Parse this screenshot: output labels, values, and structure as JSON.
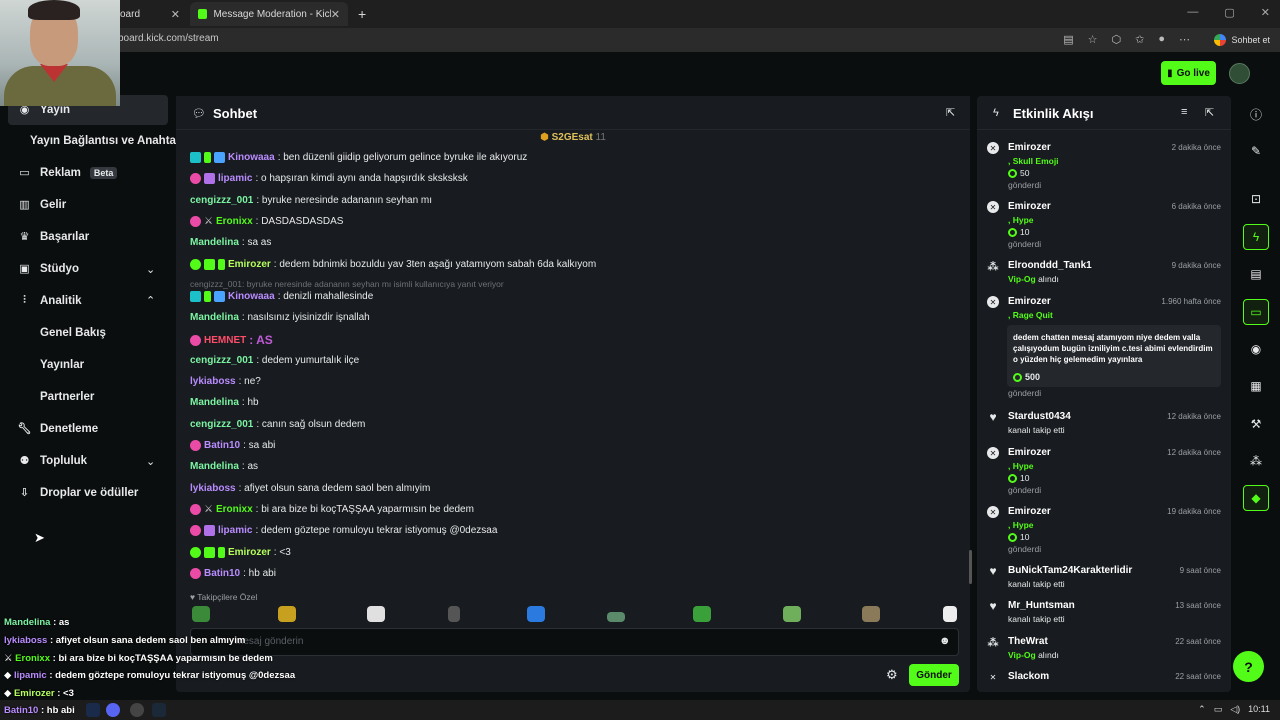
{
  "browser": {
    "tabs": [
      {
        "label": "oard",
        "active": false
      },
      {
        "label": "Message Moderation - Kick Dashb",
        "active": true
      }
    ],
    "new_tab": "+",
    "url": "board.kick.com/stream",
    "sohbet_et": "Sohbet et"
  },
  "appbar": {
    "go_live": "Go live"
  },
  "sidebar": {
    "items": [
      {
        "label": "Yayın"
      },
      {
        "label": "Yayın Bağlantısı ve Anahtarı"
      },
      {
        "label": "Reklam",
        "badge": "Beta"
      },
      {
        "label": "Gelir"
      },
      {
        "label": "Başarılar"
      },
      {
        "label": "Stüdyo"
      },
      {
        "label": "Analitik"
      },
      {
        "label": "Genel Bakış"
      },
      {
        "label": "Yayınlar"
      },
      {
        "label": "Partnerler"
      },
      {
        "label": "Denetleme"
      },
      {
        "label": "Topluluk"
      },
      {
        "label": "Droplar ve ödüller"
      }
    ]
  },
  "chat": {
    "title": "Sohbet",
    "pinned": {
      "user": "S2GEsat",
      "count": "11"
    },
    "messages": [
      {
        "user": "Kinowaaa",
        "text": ": ben düzenli giidip geliyorum gelince byruke ile akıyoruz"
      },
      {
        "user": "lipamic",
        "text": ": o hapşıran kimdi aynı anda hapşırdık sksksksk"
      },
      {
        "user": "cengizzz_001",
        "text": ": byruke neresinde adananın seyhan mı"
      },
      {
        "user": "Eronixx",
        "text": ": DASDASDASDAS"
      },
      {
        "user": "Mandelina",
        "text": ": sa as"
      },
      {
        "user": "Emirozer",
        "text": ": dedem bdnimki bozuldu yav 3ten aşağı yatamıyom sabah 6da kalkıyom"
      },
      {
        "user": "Kinowaaa",
        "text": ": denizli mahallesinde"
      },
      {
        "user": "Mandelina",
        "text": ": nasılsınız iyisinizdir işnallah"
      },
      {
        "user": "HEMNET",
        "text": ": AS"
      },
      {
        "user": "cengizzz_001",
        "text": ": dedem yumurtalık ilçe"
      },
      {
        "user": "lykiaboss",
        "text": ": ne?"
      },
      {
        "user": "Mandelina",
        "text": ": hb"
      },
      {
        "user": "cengizzz_001",
        "text": ": canın sağ olsun dedem"
      },
      {
        "user": "Batin10",
        "text": ": sa abi"
      },
      {
        "user": "Mandelina",
        "text": ": as"
      },
      {
        "user": "lykiaboss",
        "text": ": afiyet olsun sana dedem saol ben almıyim"
      },
      {
        "user": "Eronixx",
        "text": ": bi ara bize bi koçTAŞŞAA yaparmısın be dedem"
      },
      {
        "user": "lipamic",
        "text": ": dedem göztepe romuloyu tekrar istiyomuş @0dezsaa"
      },
      {
        "user": "Emirozer",
        "text": ": <3"
      },
      {
        "user": "Batin10",
        "text": ": hb abi"
      }
    ],
    "reply_preview": "cengizzz_001: byruke neresinde adananın seyhan mı isimli kullanıcıya yanıt veriyor",
    "emotes_label": "Takipçilere Özel",
    "input_placeholder": "mesaj gönderin",
    "send_label": "Gönder"
  },
  "activity": {
    "title": "Etkinlik Akışı",
    "events": [
      {
        "user": "Emirozer",
        "time": "2 dakika önce",
        "line2": ", Skull Emoji",
        "amount": "50",
        "line4": "gönderdi"
      },
      {
        "user": "Emirozer",
        "time": "6 dakika önce",
        "line2": ", Hype",
        "amount": "10",
        "line4": "gönderdi"
      },
      {
        "user": "Elroonddd_Tank1",
        "time": "9 dakika önce",
        "line2a": "Vip-Og",
        "line2b": " alındı"
      },
      {
        "user": "Emirozer",
        "time": "1.960 hafta önce",
        "line2": ", Rage Quit",
        "message": "dedem chatten mesaj atamıyom niye dedem valla çalışıyodum bugün izniliyim c.tesi abimi evlendirdim o yüzden hiç gelemedim yayınlara",
        "amount": "500",
        "line4": "gönderdi"
      },
      {
        "user": "Stardust0434",
        "time": "12 dakika önce",
        "line2plain": "kanalı takip etti"
      },
      {
        "user": "Emirozer",
        "time": "12 dakika önce",
        "line2": ", Hype",
        "amount": "10",
        "line4": "gönderdi"
      },
      {
        "user": "Emirozer",
        "time": "19 dakika önce",
        "line2": ", Hype",
        "amount": "10",
        "line4": "gönderdi"
      },
      {
        "user": "BuNickTam24Karakterlidir",
        "time": "9 saat önce",
        "line2plain": "kanalı takip etti"
      },
      {
        "user": "Mr_Huntsman",
        "time": "13 saat önce",
        "line2plain": "kanalı takip etti"
      },
      {
        "user": "TheWrat",
        "time": "22 saat önce",
        "line2a": "Vip-Og",
        "line2b": " alındı"
      },
      {
        "user": "Slackom",
        "time": "22 saat önce"
      }
    ]
  },
  "overlay": [
    {
      "user": "Mandelina",
      "text": " : as"
    },
    {
      "user": "lykiaboss",
      "text": " : afiyet olsun sana dedem saol ben almıyim"
    },
    {
      "user": "Eronixx",
      "text": " : bi ara bize bi koçTAŞŞAA yaparmısın be dedem"
    },
    {
      "user": "lipamic",
      "text": " : dedem göztepe romuloyu tekrar istiyomuş @0dezsaa"
    },
    {
      "user": "Emirozer",
      "text": " : <3"
    },
    {
      "user": "Batin10",
      "text": " : hb abi"
    }
  ],
  "taskbar": {
    "time": "10:11"
  },
  "colors": {
    "accent": "#53fc18",
    "panel": "#181b1f",
    "background": "#0b0e0f"
  }
}
